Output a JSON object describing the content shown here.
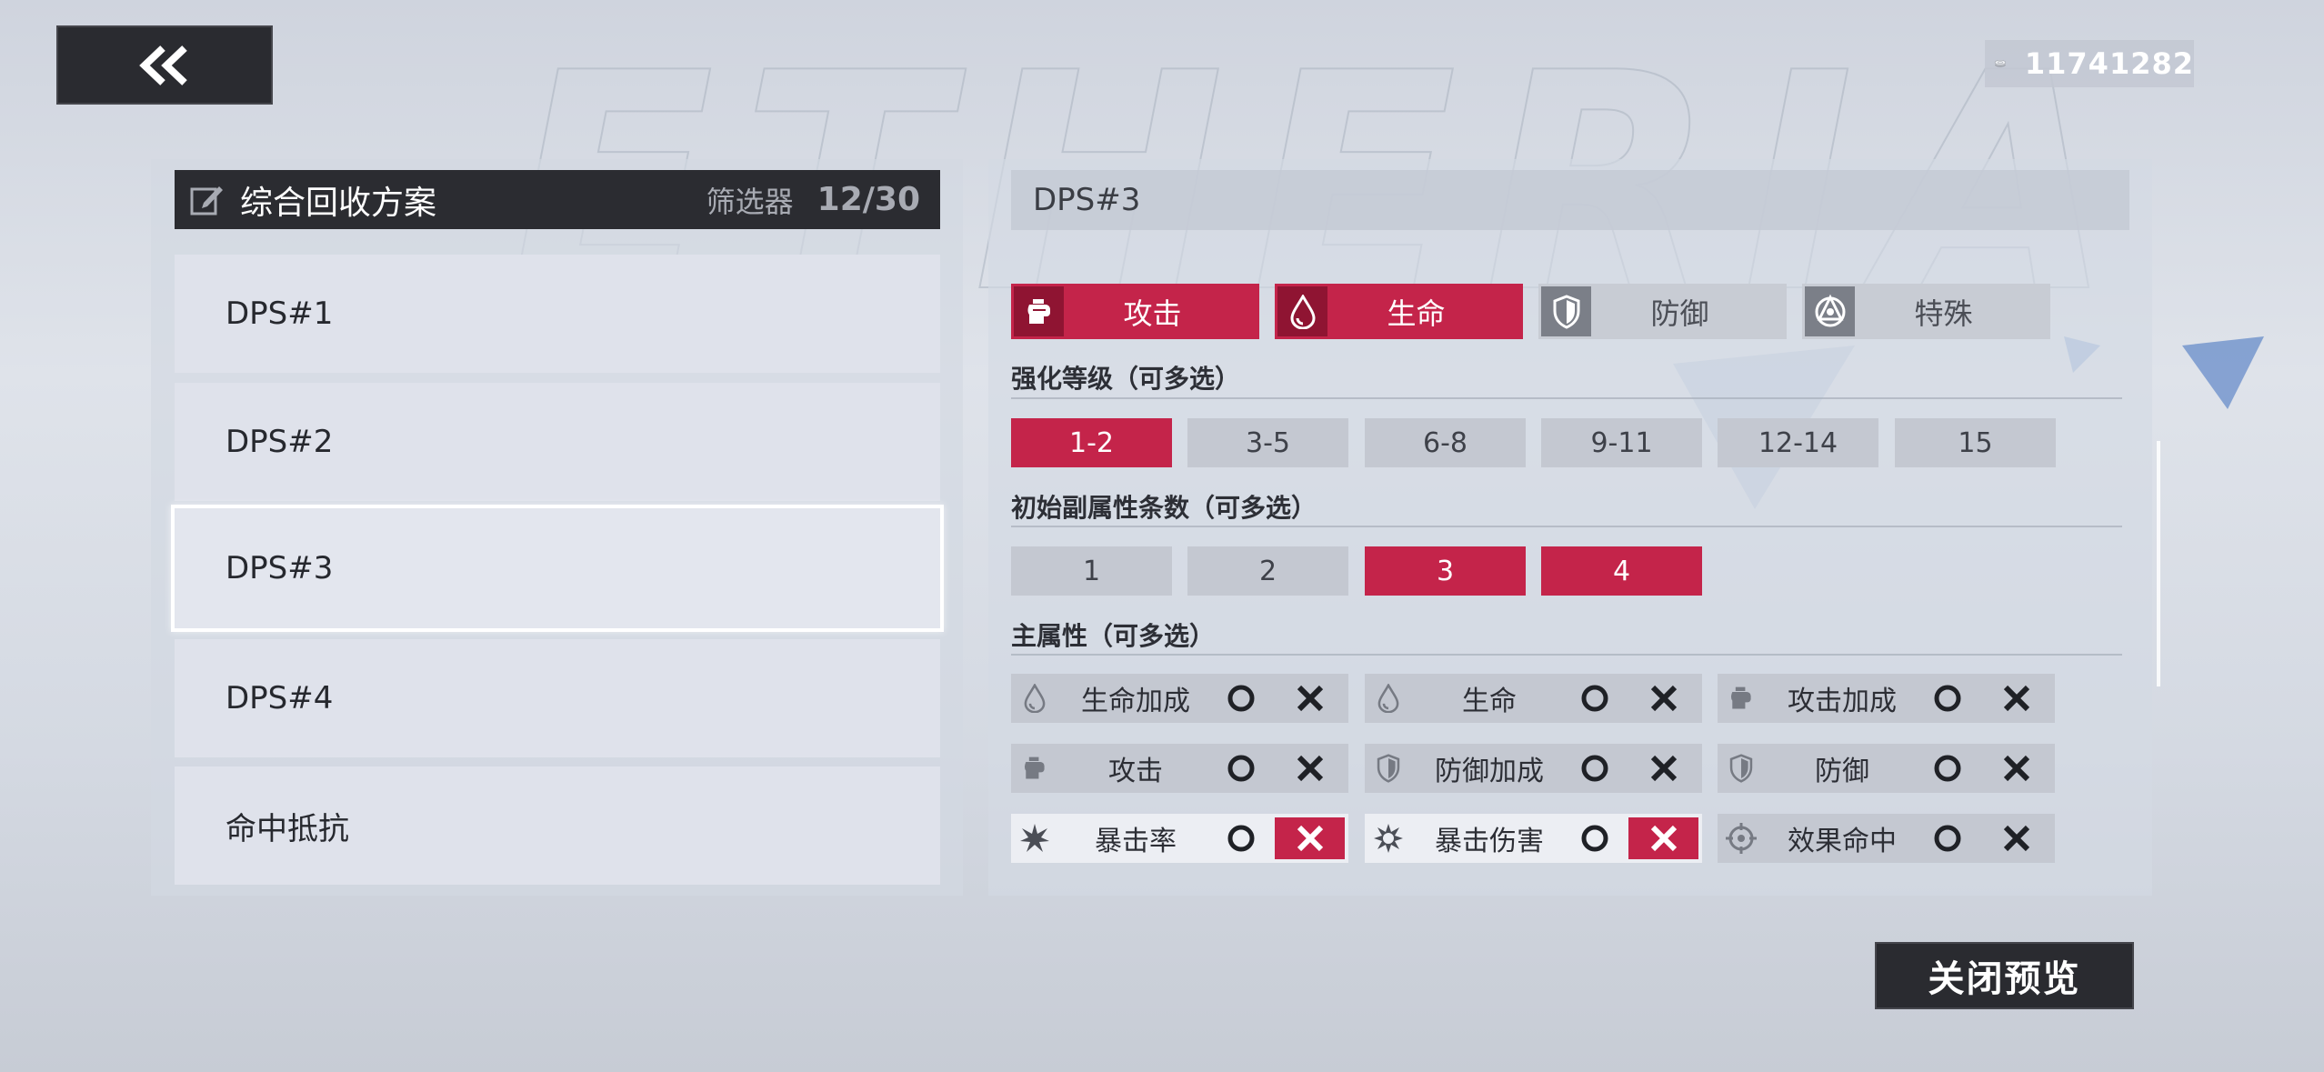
{
  "header": {
    "currency_amount": "11741282"
  },
  "left_panel": {
    "title": "综合回收方案",
    "filter_label": "筛选器",
    "filter_count": "12/30",
    "plans": [
      {
        "label": "DPS#1"
      },
      {
        "label": "DPS#2"
      },
      {
        "label": "DPS#3"
      },
      {
        "label": "DPS#4"
      },
      {
        "label": "命中抵抗"
      }
    ],
    "selected_plan": "DPS#3"
  },
  "right_panel": {
    "plan_name": "DPS#3",
    "sets": [
      {
        "label": "攻击",
        "icon": "fist-icon",
        "active": true
      },
      {
        "label": "生命",
        "icon": "drop-icon",
        "active": true
      },
      {
        "label": "防御",
        "icon": "shield-icon",
        "active": false
      },
      {
        "label": "特殊",
        "icon": "special-icon",
        "active": false
      }
    ],
    "enhance": {
      "title": "强化等级（可多选）",
      "options": [
        {
          "label": "1-2",
          "active": true
        },
        {
          "label": "3-5",
          "active": false
        },
        {
          "label": "6-8",
          "active": false
        },
        {
          "label": "9-11",
          "active": false
        },
        {
          "label": "12-14",
          "active": false
        },
        {
          "label": "15",
          "active": false
        }
      ]
    },
    "substats": {
      "title": "初始副属性条数（可多选）",
      "options": [
        {
          "label": "1",
          "active": false
        },
        {
          "label": "2",
          "active": false
        },
        {
          "label": "3",
          "active": true
        },
        {
          "label": "4",
          "active": true
        }
      ]
    },
    "main_stats": {
      "title": "主属性（可多选）",
      "items": [
        {
          "label": "生命加成",
          "icon": "drop-icon",
          "excluded": false
        },
        {
          "label": "生命",
          "icon": "drop-icon",
          "excluded": false
        },
        {
          "label": "攻击加成",
          "icon": "fist-icon",
          "excluded": false
        },
        {
          "label": "攻击",
          "icon": "fist-icon",
          "excluded": false
        },
        {
          "label": "防御加成",
          "icon": "shield-icon",
          "excluded": false
        },
        {
          "label": "防御",
          "icon": "shield-icon",
          "excluded": false
        },
        {
          "label": "暴击率",
          "icon": "burst-icon",
          "excluded": true
        },
        {
          "label": "暴击伤害",
          "icon": "gear-burst-icon",
          "excluded": true
        },
        {
          "label": "效果命中",
          "icon": "target-icon",
          "excluded": false
        }
      ]
    }
  },
  "footer": {
    "close_label": "关闭预览"
  },
  "colors": {
    "accent": "#c4244a",
    "dark": "#2a2b30"
  }
}
